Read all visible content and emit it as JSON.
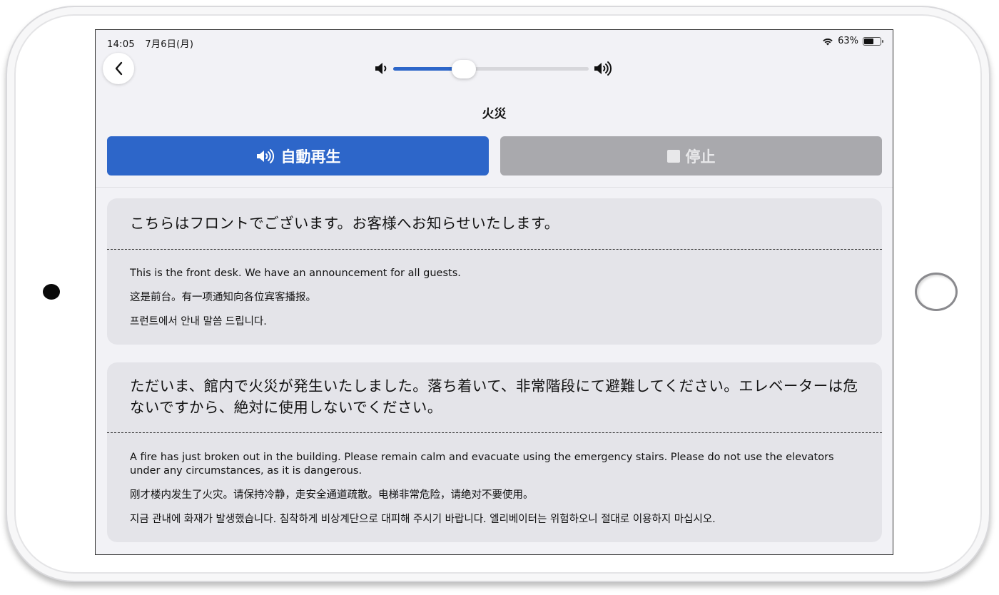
{
  "status_bar": {
    "time": "14:05",
    "date": "7月6日(月)",
    "battery_percent": "63%",
    "battery_level": 0.63
  },
  "volume": {
    "level": 0.36
  },
  "page": {
    "title": "火災"
  },
  "controls": {
    "play_label": "自動再生",
    "stop_label": "停止",
    "accent_color": "#2d66c9",
    "disabled_color": "#a9a9ad"
  },
  "announcements": [
    {
      "japanese": "こちらはフロントでございます。お客様へお知らせいたします。",
      "english": "This is the front desk. We have an announcement for all guests.",
      "chinese": "这是前台。有一项通知向各位宾客播报。",
      "korean": "프런트에서 안내 말씀 드립니다."
    },
    {
      "japanese": "ただいま、館内で火災が発生いたしました。落ち着いて、非常階段にて避難してください。エレベーターは危ないですから、絶対に使用しないでください。",
      "english": "A fire has just broken out in the building. Please remain calm and evacuate using the emergency stairs. Please do not use the elevators under any circumstances, as it is dangerous.",
      "chinese": "刚才楼内发生了火灾。请保持冷静，走安全通道疏散。电梯非常危险，请绝对不要使用。",
      "korean": "지금 관내에 화재가 발생했습니다. 침착하게 비상계단으로 대피해 주시기 바랍니다. 엘리베이터는 위험하오니 절대로 이용하지 마십시오."
    }
  ]
}
